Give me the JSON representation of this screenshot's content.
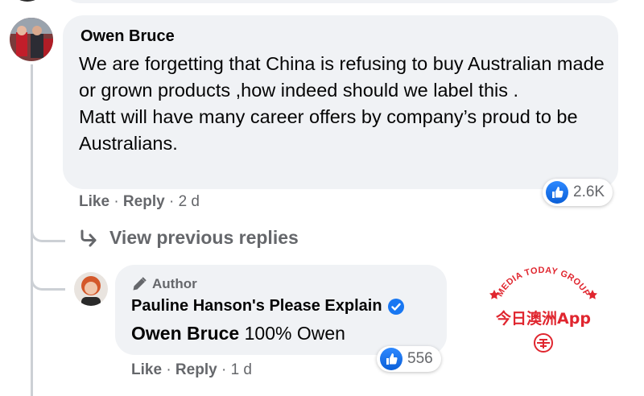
{
  "colors": {
    "bubble": "#f0f2f5",
    "meta_text": "#65676b",
    "like_blue": "#1877f2",
    "watermark_red": "#e0262f",
    "thread_line": "#ccd0d5"
  },
  "comment": {
    "author": "Owen Bruce",
    "text": "We are forgetting that China is refusing to buy Australian made or grown products ,how indeed should we label this .\nMatt will have many career offers by company’s proud to be Australians.",
    "actions": {
      "like": "Like",
      "reply": "Reply",
      "time": "2 d"
    },
    "reaction_count": "2.6K"
  },
  "view_previous": {
    "label": "View previous replies",
    "icon": "reply-arrow-icon"
  },
  "reply": {
    "badge": "Author",
    "author": "Pauline Hanson's Please Explain",
    "verified_icon": "verified-check-icon",
    "mention": "Owen Bruce",
    "text": "100% Owen",
    "actions": {
      "like": "Like",
      "reply": "Reply",
      "time": "1 d"
    },
    "reaction_count": "556"
  },
  "watermark": {
    "arc_text": "MEDIA TODAY GROUP",
    "main_text": "今日澳洲App"
  }
}
